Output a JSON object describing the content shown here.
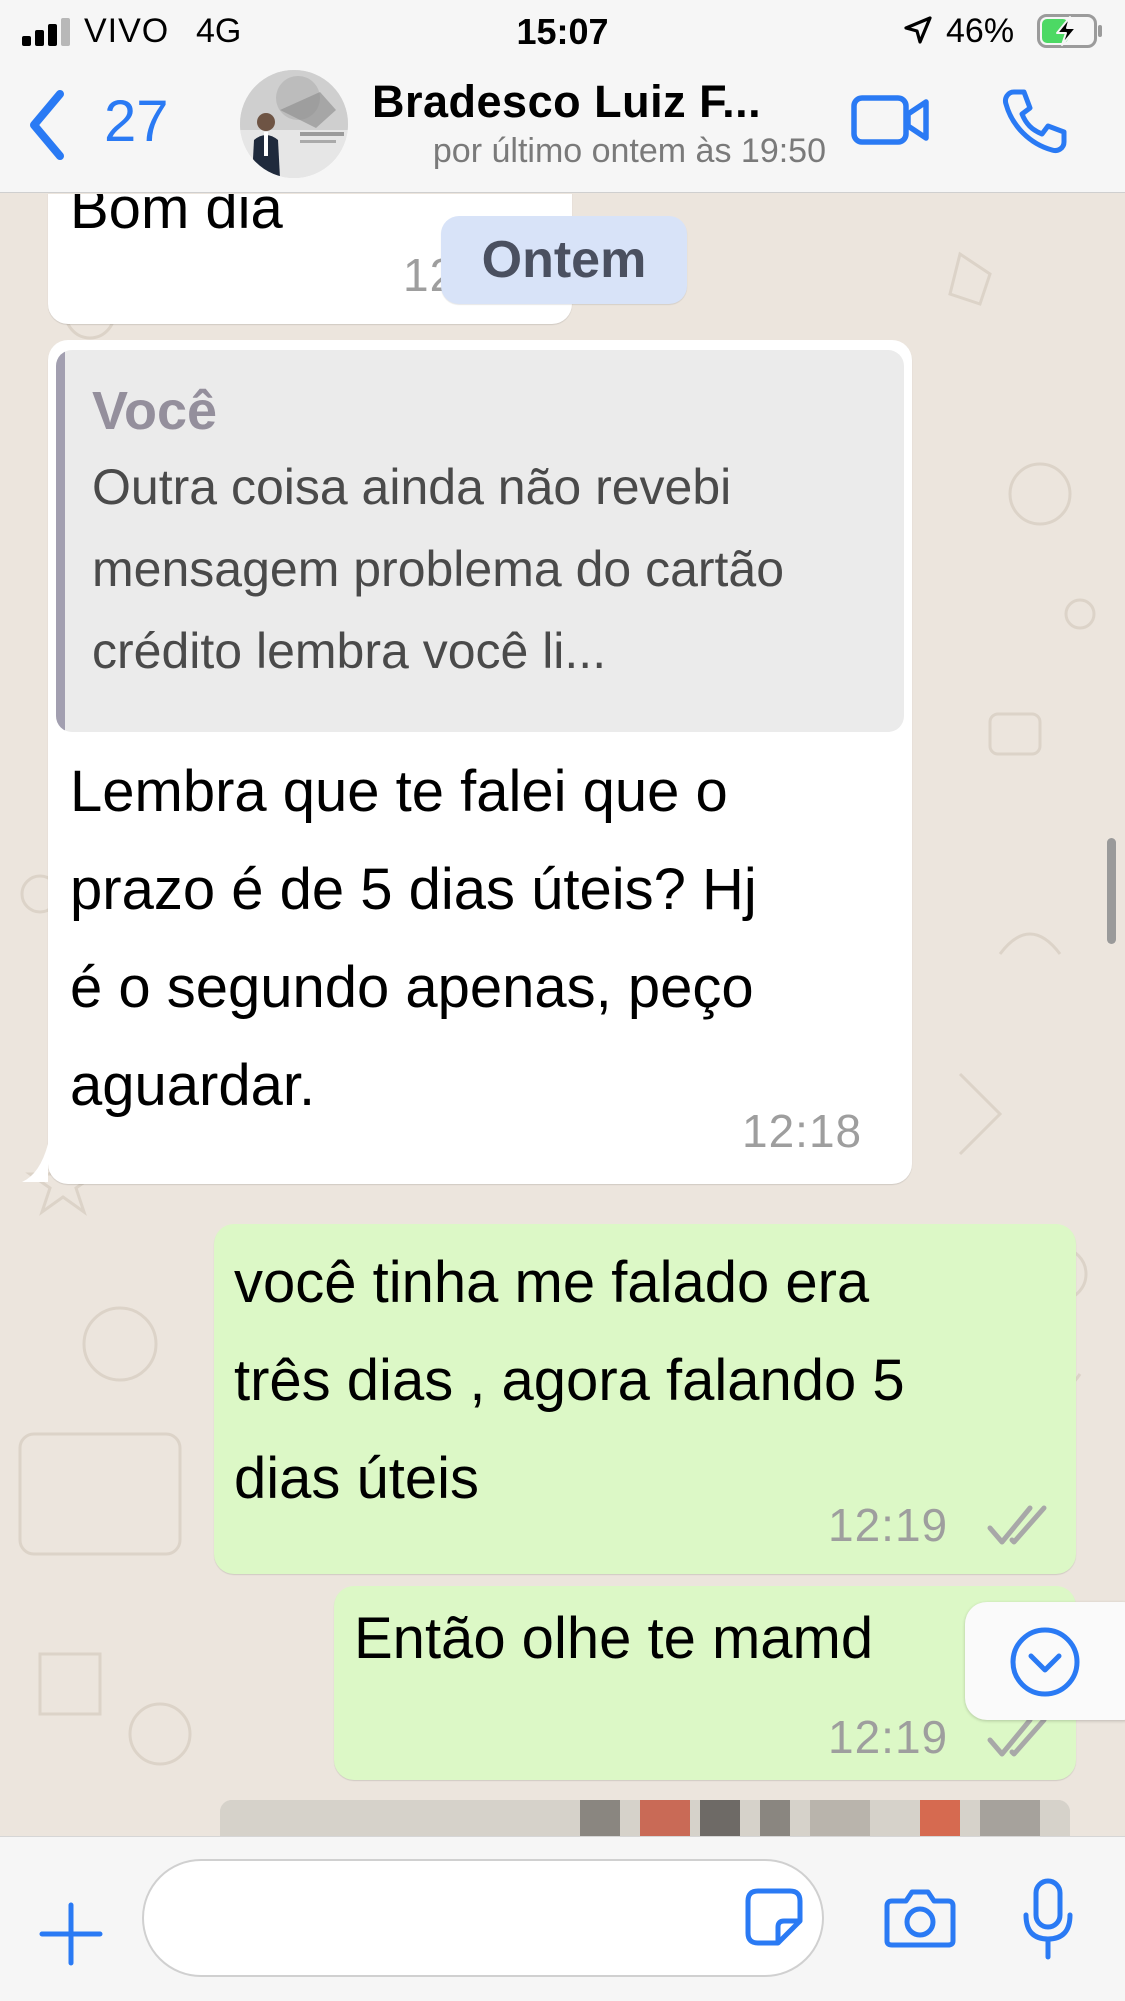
{
  "status_bar": {
    "carrier": "VIVO",
    "network": "4G",
    "time": "15:07",
    "battery_percent": "46%"
  },
  "header": {
    "back_count": "27",
    "contact_name": "Bradesco Luiz F...",
    "last_seen": "por último ontem às 19:50",
    "icons": {
      "back": "chevron-left-icon",
      "video": "video-camera-icon",
      "call": "phone-icon"
    }
  },
  "chat": {
    "date_separator": "Ontem",
    "messages": [
      {
        "direction": "incoming",
        "text": "Bom dia",
        "time_partial": "12"
      },
      {
        "direction": "incoming",
        "quote": {
          "author": "Você",
          "text": "Outra coisa ainda não revebi mensagem problema do cartão crédito lembra você li..."
        },
        "lines": [
          "Lembra que te falei que o",
          "prazo é de 5 dias úteis? Hj",
          "é o segundo apenas, peço",
          "aguardar."
        ],
        "time": "12:18"
      },
      {
        "direction": "outgoing",
        "lines": [
          "você tinha me falado era",
          "três dias , agora falando 5",
          "dias úteis"
        ],
        "time": "12:19",
        "status": "read"
      },
      {
        "direction": "outgoing",
        "text": "Então olhe te mamd",
        "time": "12:19",
        "status": "read"
      }
    ]
  },
  "input_bar": {
    "placeholder": "",
    "icons": {
      "attach": "plus-icon",
      "sticker": "sticker-icon",
      "camera": "camera-icon",
      "mic": "microphone-icon"
    }
  },
  "colors": {
    "accent": "#2a7af4",
    "incoming_bubble": "#ffffff",
    "outgoing_bubble": "#dcf8c6",
    "date_chip": "#d8e3f8",
    "chat_background": "#ece5dd",
    "battery_charging": "#4cd964"
  }
}
